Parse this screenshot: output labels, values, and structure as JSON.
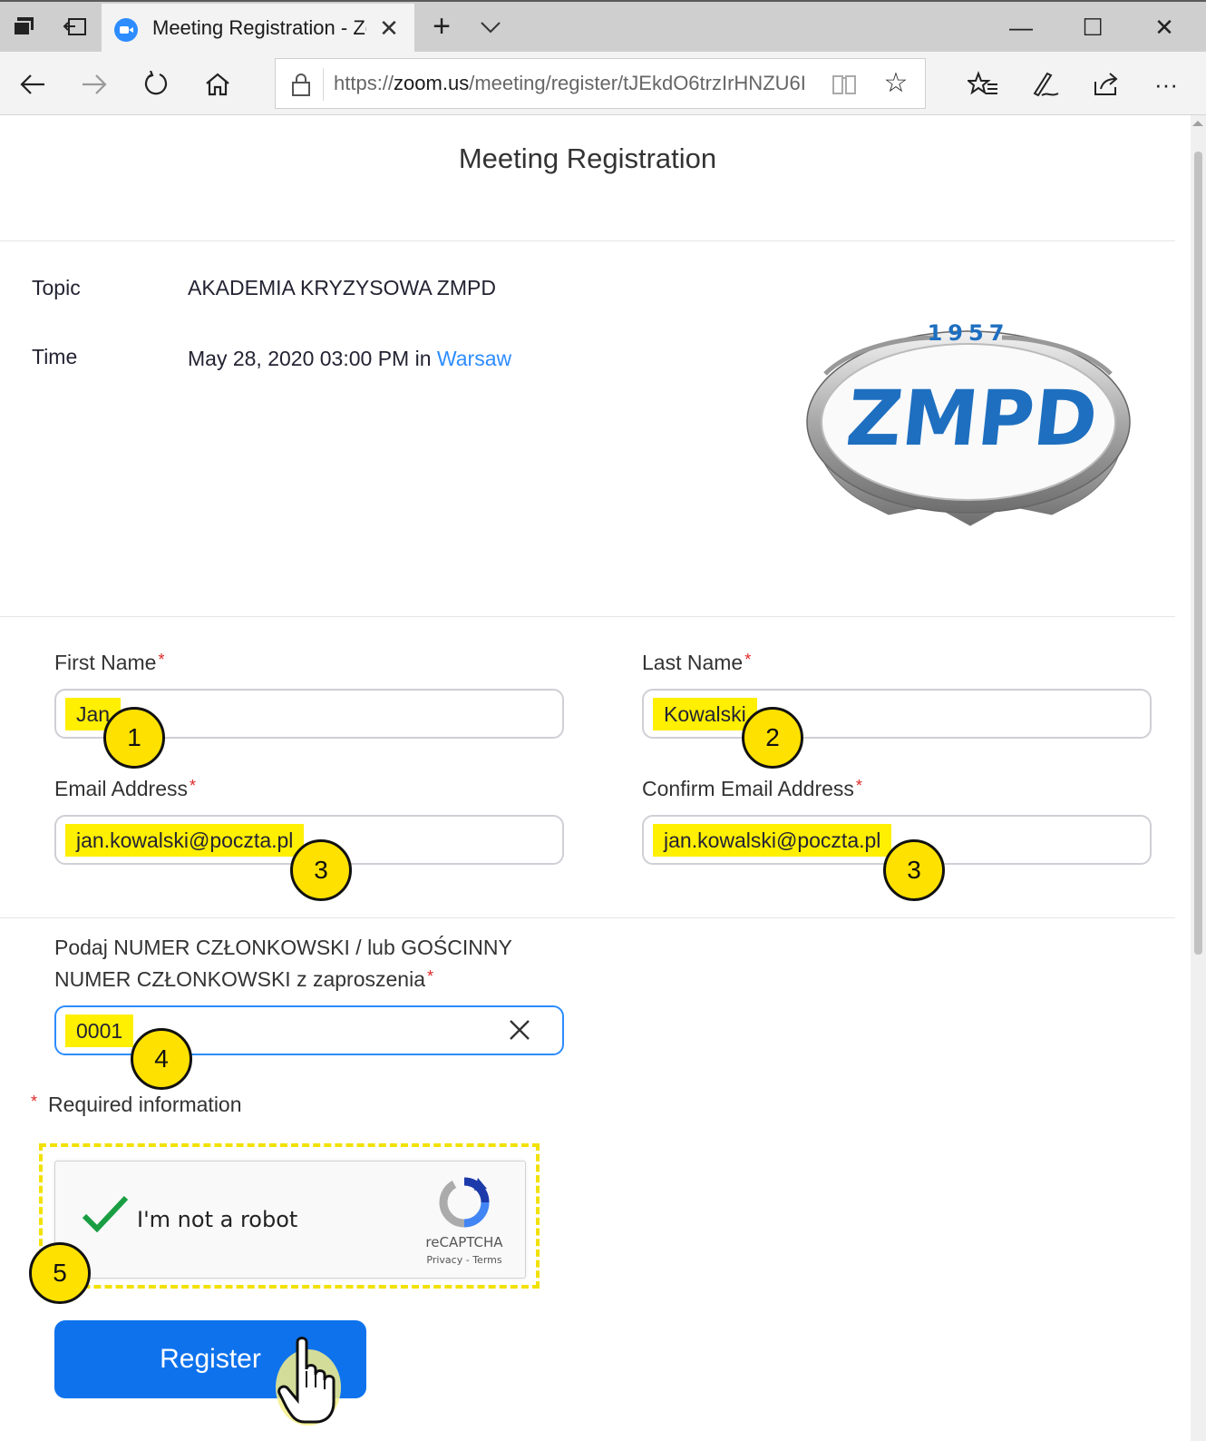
{
  "browser": {
    "tab_title": "Meeting Registration - Zoom",
    "new_tab": "+",
    "url_prefix": "https://",
    "url_domain": "zoom.us",
    "url_path": "/meeting/register/tJEkdO6trzIrHNZU6I",
    "window_controls": {
      "minimize": "—",
      "maximize": "☐",
      "close": "✕"
    },
    "more": "···"
  },
  "page": {
    "title": "Meeting Registration",
    "topic_label": "Topic",
    "topic_value": "AKADEMIA KRYZYSOWA ZMPD",
    "time_label": "Time",
    "time_value": "May 28, 2020 03:00 PM in ",
    "time_zone_link": "Warsaw",
    "logo": {
      "year": "1957",
      "text": "ZMPD",
      "color": "#1e6fc0"
    }
  },
  "form": {
    "first_name": {
      "label": "First Name",
      "value": "Jan"
    },
    "last_name": {
      "label": "Last Name",
      "value": "Kowalski"
    },
    "email": {
      "label": "Email Address",
      "value": "jan.kowalski@poczta.pl"
    },
    "confirm_email": {
      "label": "Confirm Email Address",
      "value": "jan.kowalski@poczta.pl"
    },
    "member_number": {
      "label_line1": "Podaj NUMER CZŁONKOWSKI / lub GOŚCINNY",
      "label_line2": "NUMER CZŁONKOWSKI z zaproszenia",
      "value": "0001"
    },
    "required_star": "*",
    "required_note": "Required information",
    "captcha": {
      "label": "I'm not a robot",
      "brand": "reCAPTCHA",
      "links": "Privacy - Terms"
    },
    "register_label": "Register"
  },
  "annotations": {
    "badges": [
      "1",
      "2",
      "3",
      "3",
      "4",
      "5"
    ],
    "highlight_color": "#ffef00"
  }
}
